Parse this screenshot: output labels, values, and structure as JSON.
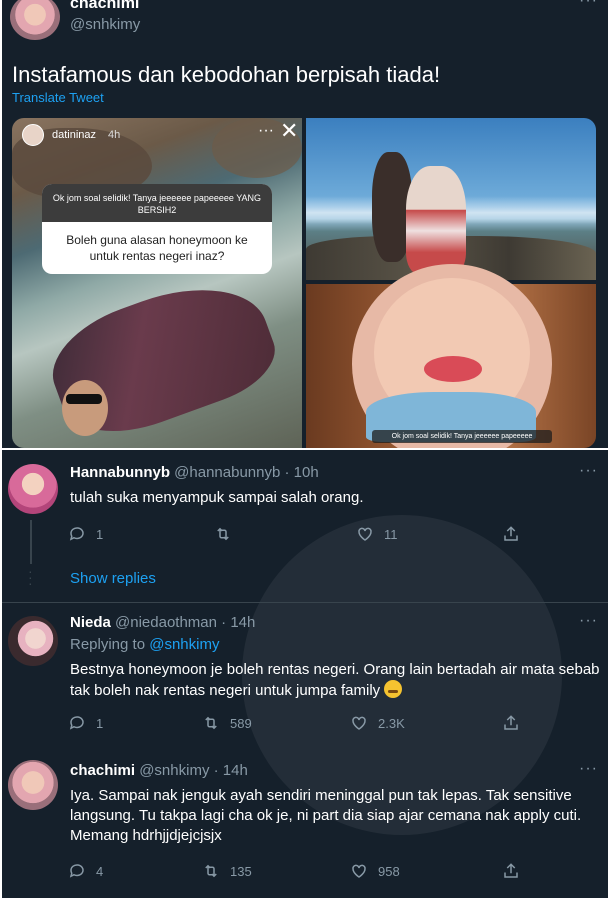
{
  "tweet": {
    "author_name": "chachimi",
    "author_handle": "@snhkimy",
    "text": "Instafamous dan kebodohan berpisah tiada!",
    "translate_label": "Translate Tweet",
    "media": {
      "story_user": "datininaz",
      "story_time": "4h",
      "question_header": "Ok jom soal selidik! Tanya jeeeeee papeeeee YANG BERSIH2",
      "question_text": "Boleh guna alasan honeymoon ke untuk rentas negeri inaz?",
      "caption_bottom": "Ok jom soal selidik! Tanya jeeeeee papeeeee"
    }
  },
  "replies": [
    {
      "name": "Hannabunnyb",
      "handle": "@hannabunnyb",
      "time": "· 10h",
      "text": "tulah suka menyampuk sampai salah orang.",
      "replies": "1",
      "retweets": "",
      "likes": "11",
      "show_replies": "Show replies"
    },
    {
      "name": "Nieda",
      "handle": "@niedaothman",
      "time": "· 14h",
      "replying_to_label": "Replying to",
      "replying_to_handle": "@snhkimy",
      "text": "Bestnya honeymoon je boleh rentas negeri. Orang lain bertadah air mata sebab tak boleh nak rentas negeri untuk jumpa family",
      "replies": "1",
      "retweets": "589",
      "likes": "2.3K"
    },
    {
      "name": "chachimi",
      "handle": "@snhkimy",
      "time": "· 14h",
      "text": "Iya. Sampai nak jenguk ayah sendiri meninggal pun tak lepas. Tak sensitive langsung. Tu takpa lagi cha ok je, ni part dia siap ajar cemana nak apply cuti. Memang hdrhjjdjejcjsjx",
      "replies": "4",
      "retweets": "135",
      "likes": "958"
    }
  ],
  "more_icon": "···",
  "colors": {
    "background": "#15202b",
    "link": "#1da1f2",
    "muted": "#8899a6",
    "divider": "#38444d"
  }
}
